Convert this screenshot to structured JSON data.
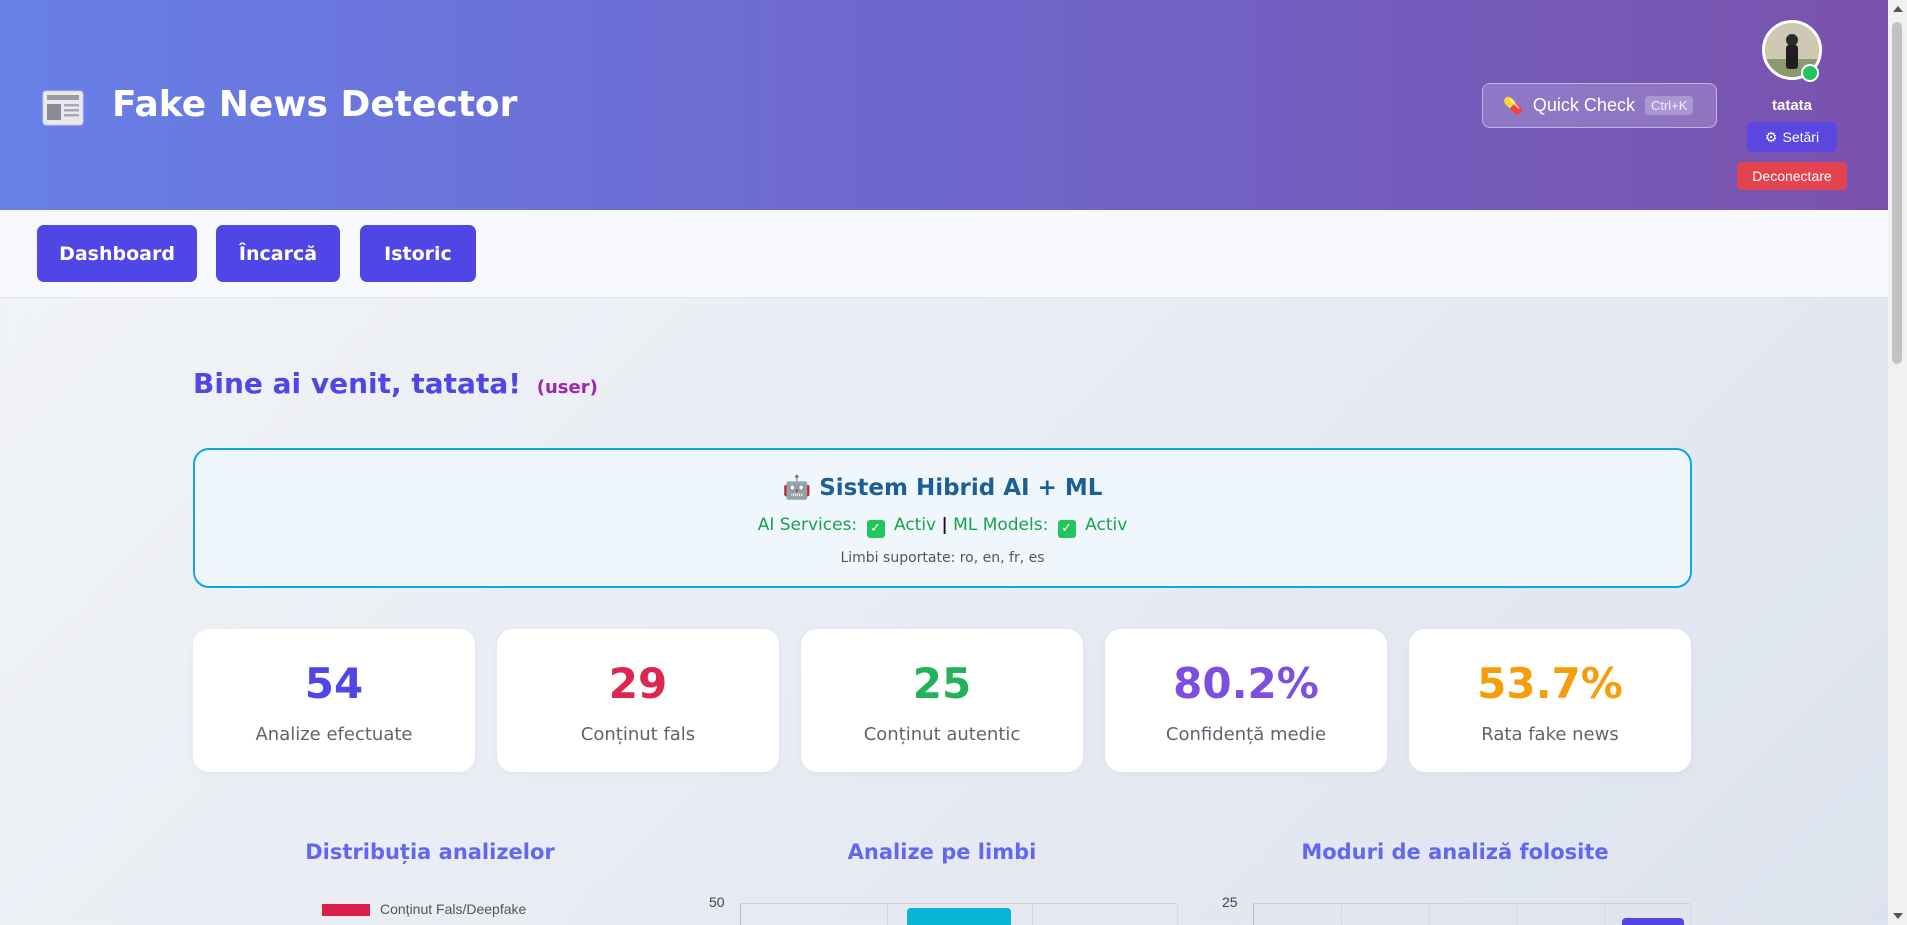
{
  "header": {
    "app_title": "Fake News Detector",
    "logo_icon": "newspaper-icon",
    "quick_check_label": "Quick Check",
    "quick_check_icon": "pill-icon",
    "quick_check_shortcut": "Ctrl+K",
    "username": "tatata",
    "settings_label": "Setări",
    "settings_icon": "gear-icon",
    "logout_label": "Deconectare"
  },
  "nav": {
    "items": [
      {
        "label": "Dashboard"
      },
      {
        "label": "Încarcă"
      },
      {
        "label": "Istoric"
      }
    ]
  },
  "welcome": {
    "text": "Bine ai venit, tatata!",
    "role": "(user)"
  },
  "ai_system": {
    "icon": "robot-icon",
    "title": "Sistem Hibrid AI + ML",
    "ai_services_label": "AI Services:",
    "ai_services_status": "Activ",
    "ml_models_label": "ML Models:",
    "ml_models_status": "Activ",
    "languages": "Limbi suportate: ro, en, fr, es"
  },
  "stats": [
    {
      "value": "54",
      "label": "Analize efectuate",
      "color": "#4f46e5"
    },
    {
      "value": "29",
      "label": "Conținut fals",
      "color": "#dc2650"
    },
    {
      "value": "25",
      "label": "Conținut autentic",
      "color": "#22b35a"
    },
    {
      "value": "80.2%",
      "label": "Confidență medie",
      "color": "#7c4fe0"
    },
    {
      "value": "53.7%",
      "label": "Rata fake news",
      "color": "#f59e0b"
    }
  ],
  "charts": {
    "distribution_title": "Distribuția analizelor",
    "distribution_legend_first": "Conținut Fals/Deepfake",
    "distribution_legend_color": "#dc1e4c",
    "languages_title": "Analize pe limbi",
    "languages_y_tick_top": "50",
    "languages_bar_color": "#06b6d4",
    "modes_title": "Moduri de analiză folosite",
    "modes_y_tick_top": "25"
  }
}
